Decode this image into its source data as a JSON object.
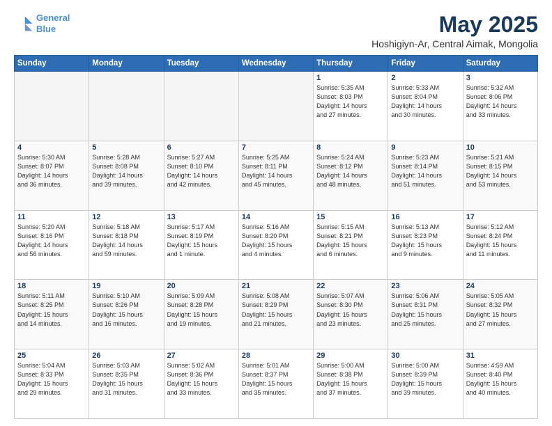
{
  "header": {
    "logo_line1": "General",
    "logo_line2": "Blue",
    "month": "May 2025",
    "location": "Hoshigiyn-Ar, Central Aimak, Mongolia"
  },
  "weekdays": [
    "Sunday",
    "Monday",
    "Tuesday",
    "Wednesday",
    "Thursday",
    "Friday",
    "Saturday"
  ],
  "weeks": [
    [
      {
        "day": "",
        "info": ""
      },
      {
        "day": "",
        "info": ""
      },
      {
        "day": "",
        "info": ""
      },
      {
        "day": "",
        "info": ""
      },
      {
        "day": "1",
        "info": "Sunrise: 5:35 AM\nSunset: 8:03 PM\nDaylight: 14 hours\nand 27 minutes."
      },
      {
        "day": "2",
        "info": "Sunrise: 5:33 AM\nSunset: 8:04 PM\nDaylight: 14 hours\nand 30 minutes."
      },
      {
        "day": "3",
        "info": "Sunrise: 5:32 AM\nSunset: 8:06 PM\nDaylight: 14 hours\nand 33 minutes."
      }
    ],
    [
      {
        "day": "4",
        "info": "Sunrise: 5:30 AM\nSunset: 8:07 PM\nDaylight: 14 hours\nand 36 minutes."
      },
      {
        "day": "5",
        "info": "Sunrise: 5:28 AM\nSunset: 8:08 PM\nDaylight: 14 hours\nand 39 minutes."
      },
      {
        "day": "6",
        "info": "Sunrise: 5:27 AM\nSunset: 8:10 PM\nDaylight: 14 hours\nand 42 minutes."
      },
      {
        "day": "7",
        "info": "Sunrise: 5:25 AM\nSunset: 8:11 PM\nDaylight: 14 hours\nand 45 minutes."
      },
      {
        "day": "8",
        "info": "Sunrise: 5:24 AM\nSunset: 8:12 PM\nDaylight: 14 hours\nand 48 minutes."
      },
      {
        "day": "9",
        "info": "Sunrise: 5:23 AM\nSunset: 8:14 PM\nDaylight: 14 hours\nand 51 minutes."
      },
      {
        "day": "10",
        "info": "Sunrise: 5:21 AM\nSunset: 8:15 PM\nDaylight: 14 hours\nand 53 minutes."
      }
    ],
    [
      {
        "day": "11",
        "info": "Sunrise: 5:20 AM\nSunset: 8:16 PM\nDaylight: 14 hours\nand 56 minutes."
      },
      {
        "day": "12",
        "info": "Sunrise: 5:18 AM\nSunset: 8:18 PM\nDaylight: 14 hours\nand 59 minutes."
      },
      {
        "day": "13",
        "info": "Sunrise: 5:17 AM\nSunset: 8:19 PM\nDaylight: 15 hours\nand 1 minute."
      },
      {
        "day": "14",
        "info": "Sunrise: 5:16 AM\nSunset: 8:20 PM\nDaylight: 15 hours\nand 4 minutes."
      },
      {
        "day": "15",
        "info": "Sunrise: 5:15 AM\nSunset: 8:21 PM\nDaylight: 15 hours\nand 6 minutes."
      },
      {
        "day": "16",
        "info": "Sunrise: 5:13 AM\nSunset: 8:23 PM\nDaylight: 15 hours\nand 9 minutes."
      },
      {
        "day": "17",
        "info": "Sunrise: 5:12 AM\nSunset: 8:24 PM\nDaylight: 15 hours\nand 11 minutes."
      }
    ],
    [
      {
        "day": "18",
        "info": "Sunrise: 5:11 AM\nSunset: 8:25 PM\nDaylight: 15 hours\nand 14 minutes."
      },
      {
        "day": "19",
        "info": "Sunrise: 5:10 AM\nSunset: 8:26 PM\nDaylight: 15 hours\nand 16 minutes."
      },
      {
        "day": "20",
        "info": "Sunrise: 5:09 AM\nSunset: 8:28 PM\nDaylight: 15 hours\nand 19 minutes."
      },
      {
        "day": "21",
        "info": "Sunrise: 5:08 AM\nSunset: 8:29 PM\nDaylight: 15 hours\nand 21 minutes."
      },
      {
        "day": "22",
        "info": "Sunrise: 5:07 AM\nSunset: 8:30 PM\nDaylight: 15 hours\nand 23 minutes."
      },
      {
        "day": "23",
        "info": "Sunrise: 5:06 AM\nSunset: 8:31 PM\nDaylight: 15 hours\nand 25 minutes."
      },
      {
        "day": "24",
        "info": "Sunrise: 5:05 AM\nSunset: 8:32 PM\nDaylight: 15 hours\nand 27 minutes."
      }
    ],
    [
      {
        "day": "25",
        "info": "Sunrise: 5:04 AM\nSunset: 8:33 PM\nDaylight: 15 hours\nand 29 minutes."
      },
      {
        "day": "26",
        "info": "Sunrise: 5:03 AM\nSunset: 8:35 PM\nDaylight: 15 hours\nand 31 minutes."
      },
      {
        "day": "27",
        "info": "Sunrise: 5:02 AM\nSunset: 8:36 PM\nDaylight: 15 hours\nand 33 minutes."
      },
      {
        "day": "28",
        "info": "Sunrise: 5:01 AM\nSunset: 8:37 PM\nDaylight: 15 hours\nand 35 minutes."
      },
      {
        "day": "29",
        "info": "Sunrise: 5:00 AM\nSunset: 8:38 PM\nDaylight: 15 hours\nand 37 minutes."
      },
      {
        "day": "30",
        "info": "Sunrise: 5:00 AM\nSunset: 8:39 PM\nDaylight: 15 hours\nand 39 minutes."
      },
      {
        "day": "31",
        "info": "Sunrise: 4:59 AM\nSunset: 8:40 PM\nDaylight: 15 hours\nand 40 minutes."
      }
    ]
  ]
}
